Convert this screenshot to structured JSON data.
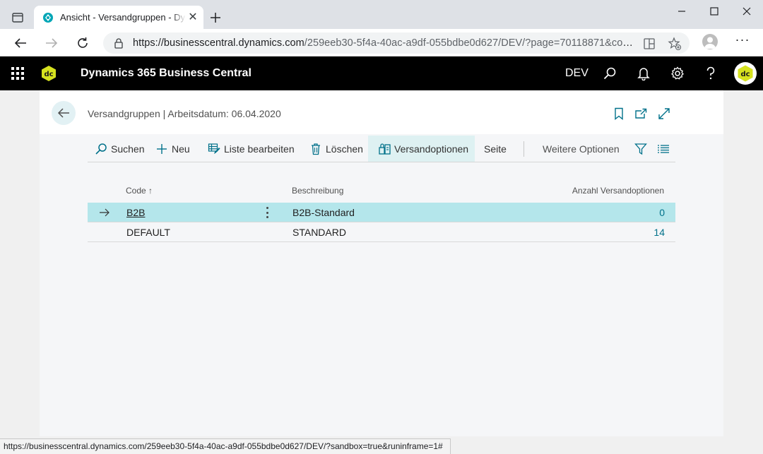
{
  "browser": {
    "tab_title": "Ansicht - Versandgruppen - Dynamics 365 Business Central",
    "url_host": "https://businesscentral.dynamics.com",
    "url_path": "/259eeb30-5f4a-40ac-a9df-055bdbe0d627/DEV/?page=70118871&compa...",
    "status_url": "https://businesscentral.dynamics.com/259eeb30-5f4a-40ac-a9df-055bdbe0d627/DEV/?sandbox=true&runinframe=1#"
  },
  "app": {
    "logo_text": "dc",
    "title": "Dynamics 365 Business Central",
    "environment": "DEV",
    "avatar_text": "dc"
  },
  "page": {
    "title": "Versandgruppen | Arbeitsdatum: 06.04.2020"
  },
  "actions": [
    {
      "label": "Suchen",
      "icon": "search-icon"
    },
    {
      "label": "Neu",
      "icon": "plus-icon"
    },
    {
      "label": "Liste bearbeiten",
      "icon": "edit-list-icon"
    },
    {
      "label": "Löschen",
      "icon": "trash-icon"
    },
    {
      "label": "Versandoptionen",
      "icon": "shipping-options-icon"
    },
    {
      "label": "Seite"
    },
    {
      "label": "Weitere Optionen"
    }
  ],
  "table": {
    "columns": [
      "Code",
      "Beschreibung",
      "Anzahl Versandoptionen"
    ],
    "sort_indicator": "↑",
    "rows": [
      {
        "code": "B2B",
        "description": "B2B-Standard",
        "count": "0"
      },
      {
        "code": "DEFAULT",
        "description": "STANDARD",
        "count": "14"
      }
    ]
  },
  "colors": {
    "header_bg": "#000000",
    "accent": "#00718a",
    "selected_row": "#b4e6eb",
    "logo_yellow": "#d6e21f"
  }
}
